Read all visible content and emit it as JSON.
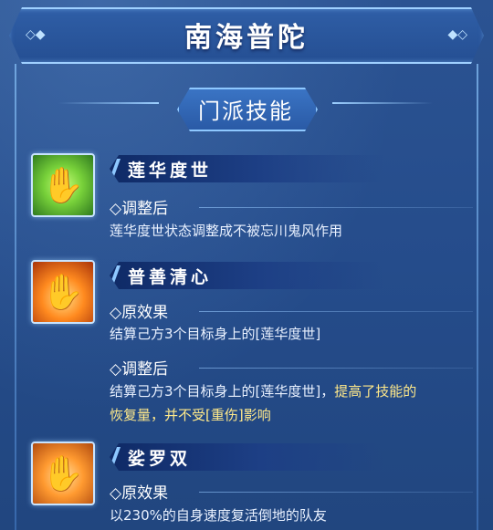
{
  "title": "南海普陀",
  "section_label": "门派技能",
  "skills": [
    {
      "name": "莲华度世",
      "blocks": [
        {
          "head": "◇调整后",
          "text": "莲华度世状态调整成不被忘川鬼风作用"
        }
      ]
    },
    {
      "name": "普善清心",
      "blocks": [
        {
          "head": "◇原效果",
          "text": "结算己方3个目标身上的[莲华度世]"
        },
        {
          "head": "◇调整后",
          "text_a": "结算己方3个目标身上的[莲华度世]，",
          "text_hl": "提高了技能的",
          "text_b": "恢复量，并不受[重伤]影响"
        }
      ]
    },
    {
      "name": "娑罗双",
      "blocks": [
        {
          "head": "◇原效果",
          "text": "以230%的自身速度复活倒地的队友"
        }
      ]
    }
  ],
  "icons": [
    "hand-glow-green-icon",
    "hand-fire-icon",
    "hand-flame-orb-icon"
  ]
}
